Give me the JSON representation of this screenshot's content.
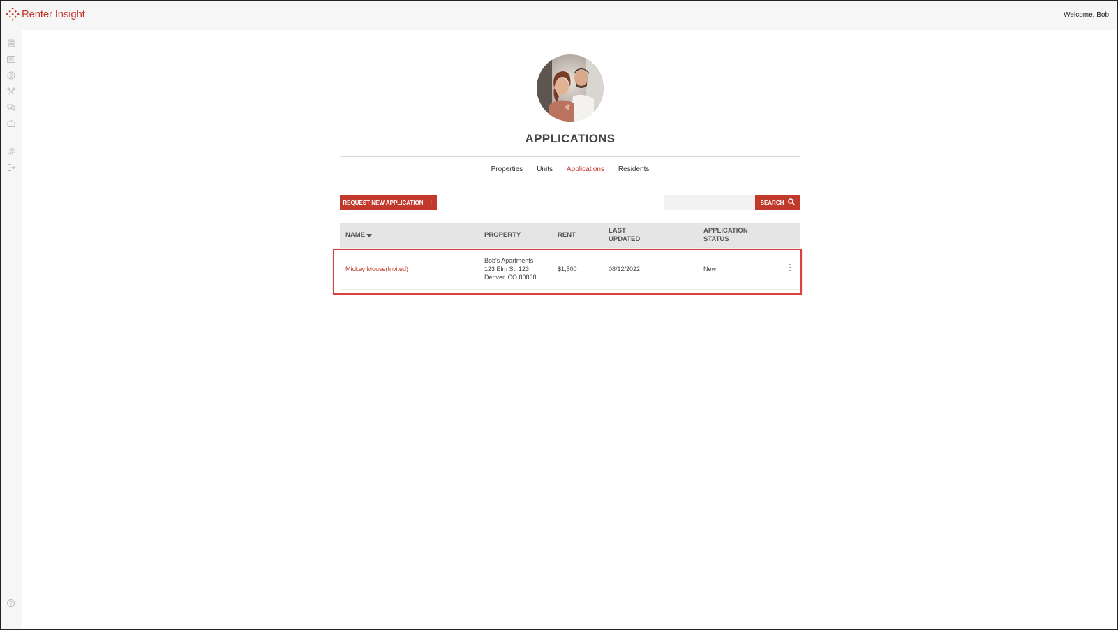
{
  "app": {
    "logo_text": "Renter Insight",
    "welcome": "Welcome, Bob"
  },
  "sidebar": {
    "icons": [
      "calculator-icon",
      "list-icon",
      "dollar-icon",
      "tools-icon",
      "chat-icon",
      "briefcase-icon",
      "gear-icon",
      "logout-icon"
    ],
    "help_icon": "help-icon"
  },
  "page": {
    "title": "APPLICATIONS"
  },
  "nav": {
    "items": [
      {
        "label": "Properties"
      },
      {
        "label": "Units"
      },
      {
        "label": "Applications"
      },
      {
        "label": "Residents"
      }
    ],
    "active": "Applications"
  },
  "toolbar": {
    "request_label": "REQUEST NEW APPLICATION",
    "search_placeholder": "",
    "search_label": "SEARCH"
  },
  "table": {
    "columns": {
      "name": "NAME",
      "property": "PROPERTY",
      "rent": "RENT",
      "last_updated_1": "LAST",
      "last_updated_2": "UPDATED",
      "status_1": "APPLICATION",
      "status_2": "STATUS"
    },
    "rows": [
      {
        "name": "Mickey Mouse(Invited)",
        "property_line1": "Bob's Apartments",
        "property_line2": "123 Elm St. 123",
        "property_line3": "Denver, CO 80808",
        "rent": "$1,500",
        "last_updated": "08/12/2022",
        "status": "New"
      }
    ]
  },
  "colors": {
    "accent": "#c0392b",
    "header_bg": "#e5e5e5",
    "highlight": "#d9403f"
  }
}
